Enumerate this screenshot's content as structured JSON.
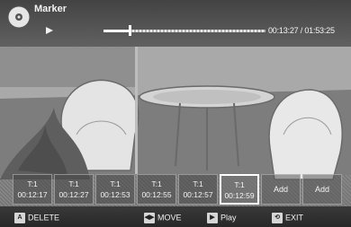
{
  "header": {
    "title": "Marker",
    "disc_icon": "disc-icon",
    "play_icon": "play-icon",
    "progress_fraction": 0.16,
    "time": "00:13:27 / 01:53:25"
  },
  "markers": [
    {
      "title": "T:1",
      "time": "00:12:17"
    },
    {
      "title": "T:1",
      "time": "00:12:27"
    },
    {
      "title": "T:1",
      "time": "00:12:53"
    },
    {
      "title": "T:1",
      "time": "00:12:55"
    },
    {
      "title": "T:1",
      "time": "00:12:57"
    },
    {
      "title": "T:1",
      "time": "00:12:59"
    },
    {
      "title": "Add"
    },
    {
      "title": "Add"
    }
  ],
  "selected_marker_index": 5,
  "help": [
    {
      "key": "A",
      "label": "DELETE",
      "icon": "button-a-icon"
    },
    {
      "key": "◀▶",
      "label": "MOVE",
      "icon": "arrows-icon"
    },
    {
      "key": "▶",
      "label": "Play",
      "icon": "play-button-icon"
    },
    {
      "key": "⟲",
      "label": "EXIT",
      "icon": "return-icon"
    }
  ],
  "colors": {
    "header_bg": "#4a4a4a",
    "text": "#f2f2f2",
    "selected_border": "#ffffff"
  }
}
